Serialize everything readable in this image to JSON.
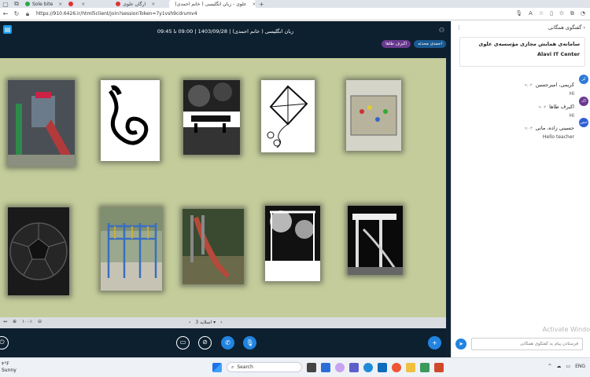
{
  "browser": {
    "tabs": [
      {
        "label": "Sole bite",
        "color": "#2aa84a"
      },
      {
        "label": "",
        "color": "#d33"
      },
      {
        "label": "ارگان علوی",
        "color": "#d33"
      },
      {
        "label": "علوی - زبان انگلیسی ( خانم احمدی)",
        "color": "#d33"
      }
    ],
    "url": "https://910.6426.ir/html5client/join?sessionToken=7y1vsh9cdrumv4"
  },
  "meeting": {
    "title": "زبان انگلیسی ( خانم احمدی) | 1403/09/28 | 09:00 تا 09:45",
    "presenters": [
      "احمدی محدثه",
      "اکبرف طاها"
    ]
  },
  "slide_nav": {
    "zoom": "۱۰۰٪",
    "slide_label": "اسلاید 3"
  },
  "chat": {
    "header": "گفتگوی همگانی",
    "notice_line1": "سامانه‌ی همایش مجازی مؤسسه‌ی علوی",
    "notice_line2": "Alavi IT Center",
    "messages": [
      {
        "name": "کریمی، امیرحسین",
        "time": "۹:۰۳",
        "text": "Hi",
        "avatar": "کر",
        "color": "#2e7bd6"
      },
      {
        "name": "اکبرف طاها",
        "time": "۹:۰۳",
        "text": "Hi",
        "avatar": "اک",
        "color": "#6a3a8f"
      },
      {
        "name": "حسینی زاده، مانی",
        "time": "۹:۰۳",
        "text": "Hello teacher",
        "avatar": "حس",
        "color": "#2e5fd6"
      }
    ],
    "input_placeholder": "فرستادن پیام به گفتگوی همگانی",
    "watermark": "Activate Windo"
  },
  "taskbar": {
    "temp": "۴°F",
    "weather": "Sunny",
    "search_placeholder": "Search",
    "lang": "ENG"
  }
}
